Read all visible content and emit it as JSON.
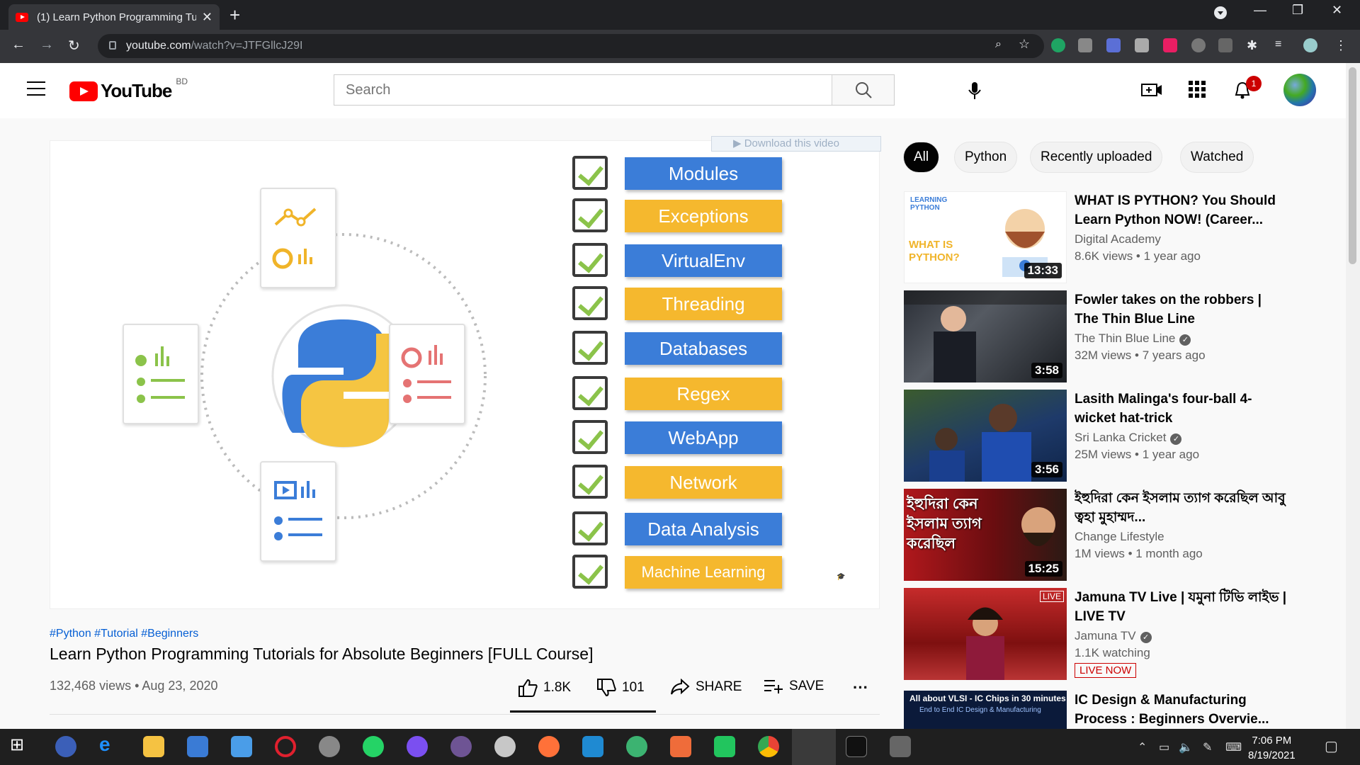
{
  "browser": {
    "tab_title": "(1) Learn Python Programming Tu",
    "tab_close": "✕",
    "new_tab": "+",
    "url_host": "youtube.com",
    "url_path": "/watch?v=JTFGllcJ29I",
    "win_min": "—",
    "win_max": "❐",
    "win_close": "✕"
  },
  "youtube": {
    "logo_text": "YouTube",
    "region": "BD",
    "search_placeholder": "Search",
    "notification_count": "1"
  },
  "video": {
    "download_label": "▶ Download this video",
    "topics": [
      {
        "label": "Modules",
        "color": "#3b7dd8"
      },
      {
        "label": "Exceptions",
        "color": "#f5b82e"
      },
      {
        "label": "VirtualEnv",
        "color": "#3b7dd8"
      },
      {
        "label": "Threading",
        "color": "#f5b82e"
      },
      {
        "label": "Databases",
        "color": "#3b7dd8"
      },
      {
        "label": "Regex",
        "color": "#f5b82e"
      },
      {
        "label": "WebApp",
        "color": "#3b7dd8"
      },
      {
        "label": "Network",
        "color": "#f5b82e"
      },
      {
        "label": "Data Analysis",
        "color": "#3b7dd8"
      },
      {
        "label": "Machine Learning",
        "color": "#f5b82e"
      }
    ],
    "hashtags": "#Python #Tutorial #Beginners",
    "title": "Learn Python Programming Tutorials for Absolute Beginners [FULL Course]",
    "views_date": "132,468 views • Aug 23, 2020",
    "likes": "1.8K",
    "dislikes": "101",
    "share_label": "SHARE",
    "save_label": "SAVE",
    "more_label": "···"
  },
  "chips": [
    "All",
    "Python",
    "Recently uploaded",
    "Watched"
  ],
  "recommendations": [
    {
      "title": "WHAT IS PYTHON? You Should Learn Python NOW! (Career...",
      "channel": "Digital Academy",
      "views": "8.6K views • 1 year ago",
      "duration": "13:33",
      "verified": false,
      "live": false
    },
    {
      "title": "Fowler takes on the robbers | The Thin Blue Line",
      "channel": "The Thin Blue Line",
      "views": "32M views • 7 years ago",
      "duration": "3:58",
      "verified": true,
      "live": false
    },
    {
      "title": "Lasith Malinga's four-ball 4-wicket hat-trick",
      "channel": "Sri Lanka Cricket",
      "views": "25M views • 1 year ago",
      "duration": "3:56",
      "verified": true,
      "live": false
    },
    {
      "title": "ইহুদিরা কেন ইসলাম ত্যাগ করেছিল আবু ত্বহা মুহাম্মদ...",
      "channel": "Change Lifestyle",
      "views": "1M views • 1 month ago",
      "duration": "15:25",
      "verified": false,
      "live": false
    },
    {
      "title": "Jamuna TV Live | যমুনা টিভি লাইভ | LIVE TV",
      "channel": "Jamuna TV",
      "views": "1.1K watching",
      "duration": "",
      "verified": true,
      "live": true,
      "live_label": "LIVE NOW",
      "thumb_badge": "LIVE"
    },
    {
      "title": "IC Design & Manufacturing Process : Beginners Overvie...",
      "channel": "",
      "views": "",
      "duration": "",
      "verified": false,
      "live": false,
      "thumb_text": "All about VLSI - IC Chips in 30 minutes"
    }
  ],
  "thumb_texts": {
    "r0": "WHAT IS PYTHON?",
    "r0_brand": "LEARNING PYTHON",
    "r3": "ইহুদিরা কেন ইসলাম ত্যাগ করেছিল",
    "r5_sub": "End to End IC Design & Manufacturing"
  },
  "taskbar": {
    "time": "7:06 PM",
    "date": "8/19/2021"
  }
}
